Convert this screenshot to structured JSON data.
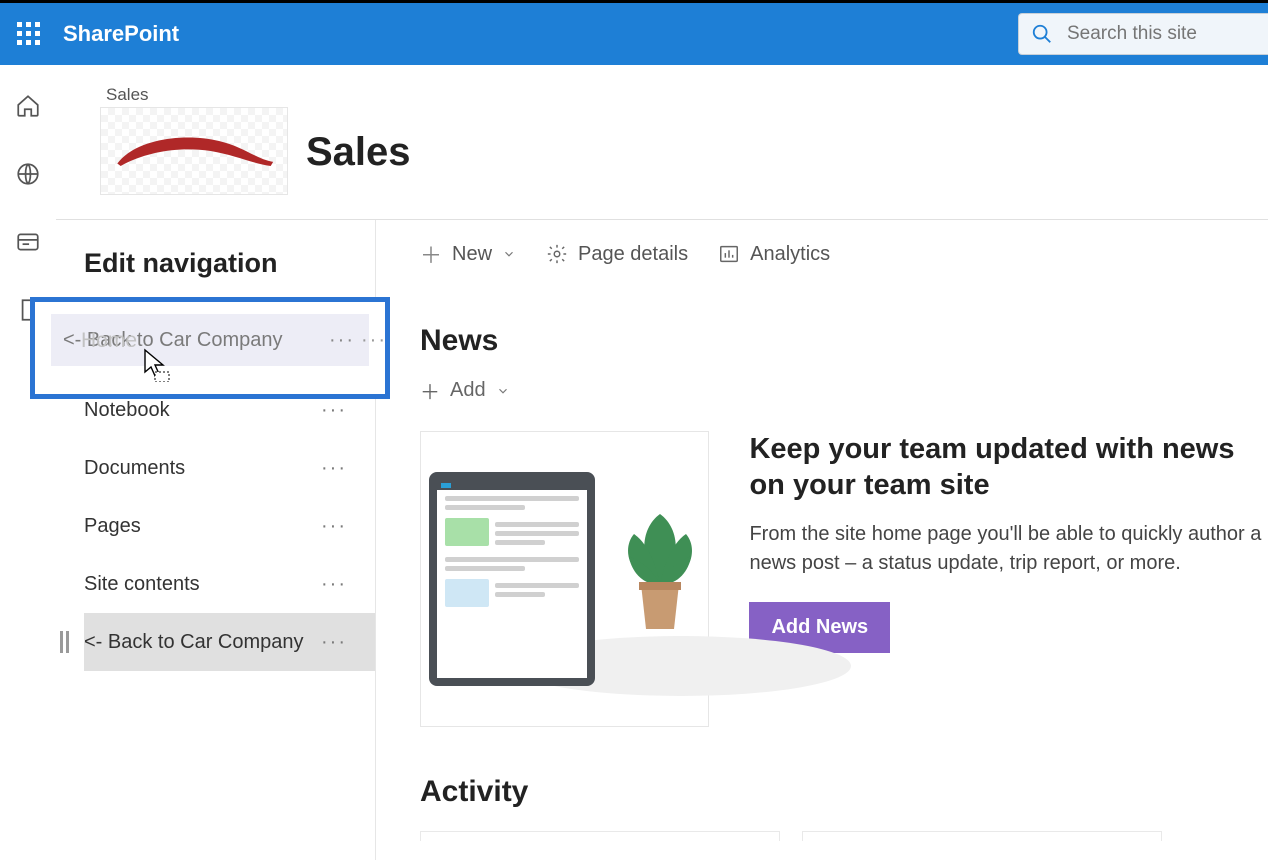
{
  "brand": "SharePoint",
  "search": {
    "placeholder": "Search this site"
  },
  "site": {
    "breadcrumb": "Sales",
    "title": "Sales"
  },
  "editNav": {
    "title": "Edit navigation",
    "draggingItem": "<- Back to Car Company",
    "ghostBehind": "Home",
    "items": [
      {
        "label": "Notebook"
      },
      {
        "label": "Documents"
      },
      {
        "label": "Pages"
      },
      {
        "label": "Site contents"
      },
      {
        "label": "<- Back to Car Company",
        "selected": true
      }
    ]
  },
  "commandBar": {
    "new": "New",
    "pageDetails": "Page details",
    "analytics": "Analytics"
  },
  "news": {
    "heading": "News",
    "add": "Add",
    "promo": {
      "title": "Keep your team updated with news on your team site",
      "body": "From the site home page you'll be able to quickly author a news post – a status update, trip report, or more.",
      "button": "Add News"
    }
  },
  "activity": {
    "heading": "Activity"
  }
}
